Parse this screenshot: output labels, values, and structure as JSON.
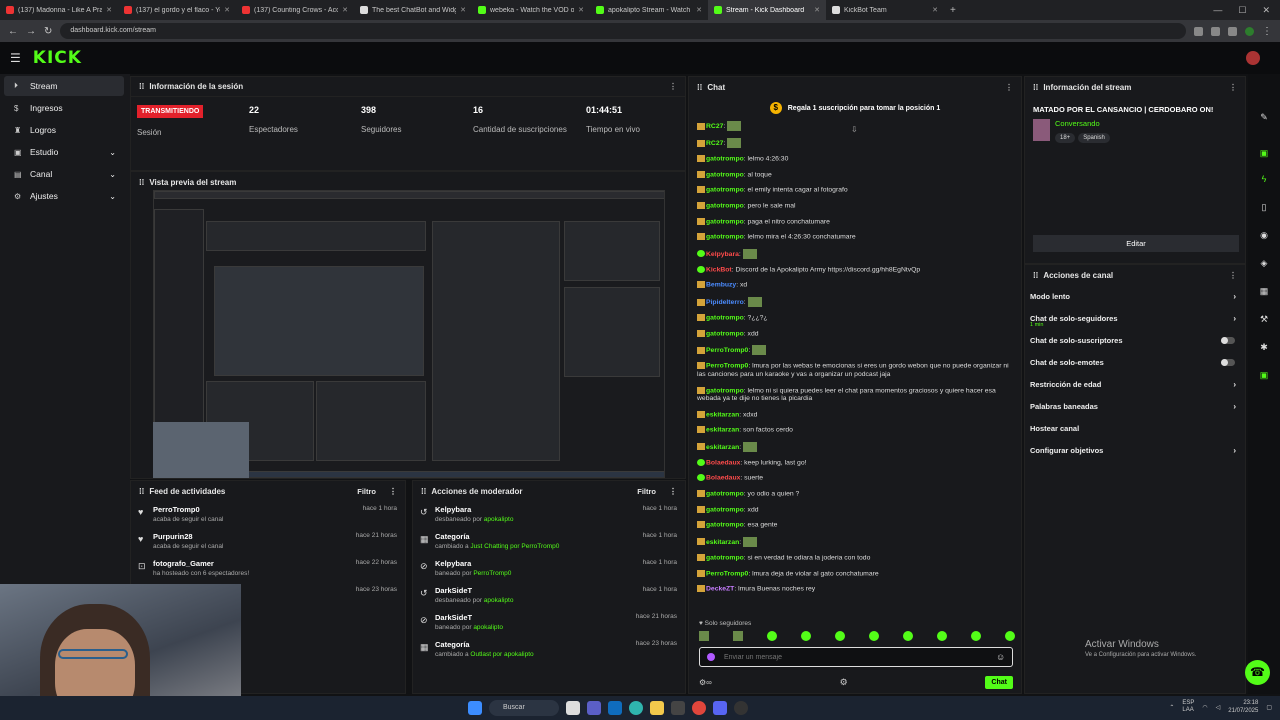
{
  "browser": {
    "tabs": [
      {
        "title": "(137) Madonna - Like A Praye...",
        "color": "#e33"
      },
      {
        "title": "(137) el gordo y el flaco - YouT...",
        "color": "#e33"
      },
      {
        "title": "(137) Counting Crows - Accide...",
        "color": "#e33"
      },
      {
        "title": "The best ChatBot and Widget...",
        "color": "#ddd"
      },
      {
        "title": "webeka - Watch the VOD on K...",
        "color": "#53fc18"
      },
      {
        "title": "apokalipto Stream - Watch Live...",
        "color": "#53fc18"
      },
      {
        "title": "Stream - Kick Dashboard",
        "color": "#53fc18"
      },
      {
        "title": "KickBot Team",
        "color": "#ddd"
      }
    ],
    "new_tab": "+",
    "url": "dashboard.kick.com/stream"
  },
  "header": {
    "logo": "KICK"
  },
  "sidebar": {
    "items": [
      {
        "label": "Stream",
        "icon": "play-icon"
      },
      {
        "label": "Ingresos",
        "icon": "money-icon"
      },
      {
        "label": "Logros",
        "icon": "trophy-icon"
      },
      {
        "label": "Estudio",
        "icon": "studio-icon"
      },
      {
        "label": "Canal",
        "icon": "channel-icon"
      },
      {
        "label": "Ajustes",
        "icon": "gear-icon"
      }
    ]
  },
  "session": {
    "title": "Información de la sesión",
    "live_badge": "TRANSMITIENDO",
    "session_label": "Sesión",
    "stats": [
      {
        "value": "22",
        "label": "Espectadores"
      },
      {
        "value": "398",
        "label": "Seguidores"
      },
      {
        "value": "16",
        "label": "Cantidad de suscripciones"
      },
      {
        "value": "01:44:51",
        "label": "Tiempo en vivo"
      }
    ]
  },
  "preview": {
    "title": "Vista previa del stream"
  },
  "feed": {
    "title": "Feed de actividades",
    "filter": "Filtro",
    "items": [
      {
        "name": "PerroTromp0",
        "sub": "acaba de seguir el canal",
        "time": "hace 1 hora"
      },
      {
        "name": "Purpurin28",
        "sub": "acaba de seguir el canal",
        "time": "hace 21 horas"
      },
      {
        "name": "fotografo_Gamer",
        "sub": "ha hosteado con 6 espectadores!",
        "time": "hace 22 horas"
      },
      {
        "name": "",
        "sub": "",
        "time": "hace 23 horas"
      }
    ]
  },
  "modactions": {
    "title": "Acciones de moderador",
    "filter": "Filtro",
    "items": [
      {
        "name": "Kelpybara",
        "sub": "desbaneado por ",
        "by": "apokalipto",
        "time": "hace 1 hora"
      },
      {
        "name": "Categoría",
        "sub": "cambiado a ",
        "by": "Just Chatting por PerroTromp0",
        "time": "hace 1 hora"
      },
      {
        "name": "Kelpybara",
        "sub": "baneado por ",
        "by": "PerroTromp0",
        "time": "hace 1 hora"
      },
      {
        "name": "DarkSideT",
        "sub": "desbaneado por ",
        "by": "apokalipto",
        "time": "hace 1 hora"
      },
      {
        "name": "DarkSideT",
        "sub": "baneado por ",
        "by": "apokalipto",
        "time": "hace 21 horas"
      },
      {
        "name": "Categoría",
        "sub": "cambiado a ",
        "by": "Outlast por apokalipto",
        "time": "hace 23 horas"
      }
    ]
  },
  "chat": {
    "title": "Chat",
    "promo": "Regala 1 suscripción para tomar la posición 1",
    "messages": [
      {
        "user": "RC27",
        "cls": "",
        "text": ""
      },
      {
        "user": "RC27",
        "cls": "",
        "text": ""
      },
      {
        "user": "gatotrompo",
        "cls": "",
        "text": "lelmo 4:26:30"
      },
      {
        "user": "gatotrompo",
        "cls": "",
        "text": "al toque"
      },
      {
        "user": "gatotrompo",
        "cls": "",
        "text": "el emily intenta cagar al fotografo"
      },
      {
        "user": "gatotrompo",
        "cls": "",
        "text": "pero le sale mal"
      },
      {
        "user": "gatotrompo",
        "cls": "",
        "text": "paga el nitro conchatumare"
      },
      {
        "user": "gatotrompo",
        "cls": "",
        "text": "lelmo mira el 4:26:30 conchatumare"
      },
      {
        "user": "Kelpybara",
        "cls": "r",
        "text": ""
      },
      {
        "user": "KickBot",
        "cls": "r",
        "text": "Discord de la Apokalipto Army https://discord.gg/hh8EgNtvQp"
      },
      {
        "user": "Bembuzy",
        "cls": "b",
        "text": "xd"
      },
      {
        "user": "Pipidelterro",
        "cls": "b",
        "text": ""
      },
      {
        "user": "gatotrompo",
        "cls": "",
        "text": "?¿¿?¿"
      },
      {
        "user": "gatotrompo",
        "cls": "",
        "text": "xdd"
      },
      {
        "user": "PerroTromp0",
        "cls": "",
        "text": ""
      },
      {
        "user": "PerroTromp0",
        "cls": "",
        "text": "lmura por las webas te emocionas si eres un gordo webon que no puede organizar ni las canciones para un karaoke y vas a organizar un podcast jaja"
      },
      {
        "user": "gatotrompo",
        "cls": "",
        "text": "lelmo ni si quiera puedes leer el chat para momentos graciosos y quiere hacer esa webada ya te dije no tienes la picardia"
      },
      {
        "user": "eskitarzan",
        "cls": "",
        "text": "xdxd"
      },
      {
        "user": "eskitarzan",
        "cls": "",
        "text": "son factos cerdo"
      },
      {
        "user": "eskitarzan",
        "cls": "",
        "text": ""
      },
      {
        "user": "Bolaedaux",
        "cls": "r",
        "text": "keep lurking, last go!"
      },
      {
        "user": "Bolaedaux",
        "cls": "r",
        "text": "suerte"
      },
      {
        "user": "gatotrompo",
        "cls": "",
        "text": "yo odio a quien ?"
      },
      {
        "user": "gatotrompo",
        "cls": "",
        "text": "xdd"
      },
      {
        "user": "gatotrompo",
        "cls": "",
        "text": "esa gente"
      },
      {
        "user": "eskitarzan",
        "cls": "",
        "text": ""
      },
      {
        "user": "gatotrompo",
        "cls": "",
        "text": "si en verdad te odiara la joderia con todo"
      },
      {
        "user": "PerroTromp0",
        "cls": "",
        "text": "lmura deja de violar al gato conchatumare"
      },
      {
        "user": "DeckeZT",
        "cls": "p",
        "text": "lmura Buenas noches rey"
      }
    ],
    "followers_only": "♥ Solo seguidores",
    "input_placeholder": "Enviar un mensaje",
    "send_label": "Chat"
  },
  "stream_info": {
    "title": "Información del stream",
    "stream_title": "MATADO POR EL CANSANCIO | CERDOBARO ON!",
    "category": "Conversando",
    "tags": [
      "18+",
      "Spanish"
    ],
    "edit_label": "Editar"
  },
  "channel_actions": {
    "title": "Acciones de canal",
    "items": [
      {
        "label": "Modo lento",
        "sub": "",
        "control": "chevron"
      },
      {
        "label": "Chat de solo-seguidores",
        "sub": "1 min",
        "control": "chevron"
      },
      {
        "label": "Chat de solo-suscriptores",
        "sub": "",
        "control": "toggle"
      },
      {
        "label": "Chat de solo-emotes",
        "sub": "",
        "control": "toggle"
      },
      {
        "label": "Restricción de edad",
        "sub": "",
        "control": "chevron"
      },
      {
        "label": "Palabras baneadas",
        "sub": "",
        "control": "chevron"
      },
      {
        "label": "Hostear canal",
        "sub": "",
        "control": "none"
      },
      {
        "label": "Configurar objetivos",
        "sub": "",
        "control": "chevron"
      }
    ]
  },
  "windows": {
    "activate_title": "Activar Windows",
    "activate_sub": "Ve a Configuración para activar Windows.",
    "search_label": "Buscar",
    "tray_lang": "ESP\nLAA",
    "time": "23:18",
    "date": "21/07/2025"
  }
}
